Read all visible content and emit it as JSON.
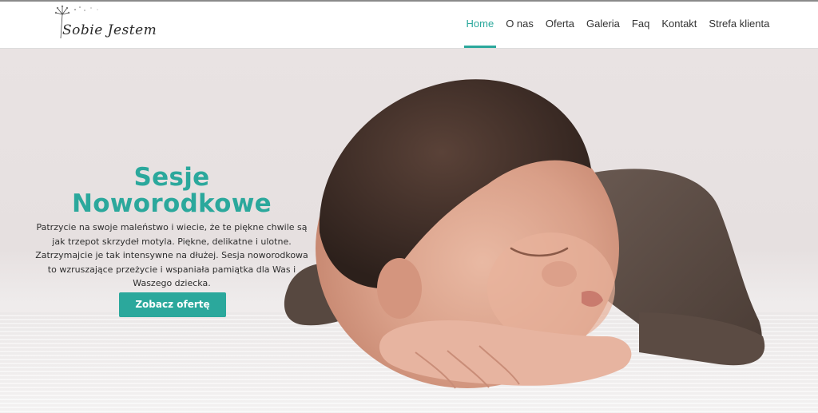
{
  "logo": {
    "text": "Sobie Jestem"
  },
  "nav": {
    "items": [
      {
        "label": "Home",
        "active": true
      },
      {
        "label": "O nas"
      },
      {
        "label": "Oferta"
      },
      {
        "label": "Galeria"
      },
      {
        "label": "Faq"
      },
      {
        "label": "Kontakt"
      },
      {
        "label": "Strefa klienta"
      }
    ]
  },
  "hero": {
    "title_line1": "Sesje",
    "title_line2": "Noworodkowe",
    "description": "Patrzycie na swoje maleństwo i wiecie, że te piękne chwile są jak trzepot skrzydeł motyla. Piękne, delikatne i ulotne. Zatrzymajcie je tak intensywne na dłużej. Sesja noworodkowa to wzruszające przeżycie i wspaniała pamiątka dla Was i Waszego dziecka.",
    "cta_label": "Zobacz ofertę",
    "image_subject": "sleeping newborn baby in brown romper on white blanket"
  },
  "colors": {
    "accent": "#2ba89c",
    "text": "#333333",
    "background": "#ffffff"
  }
}
